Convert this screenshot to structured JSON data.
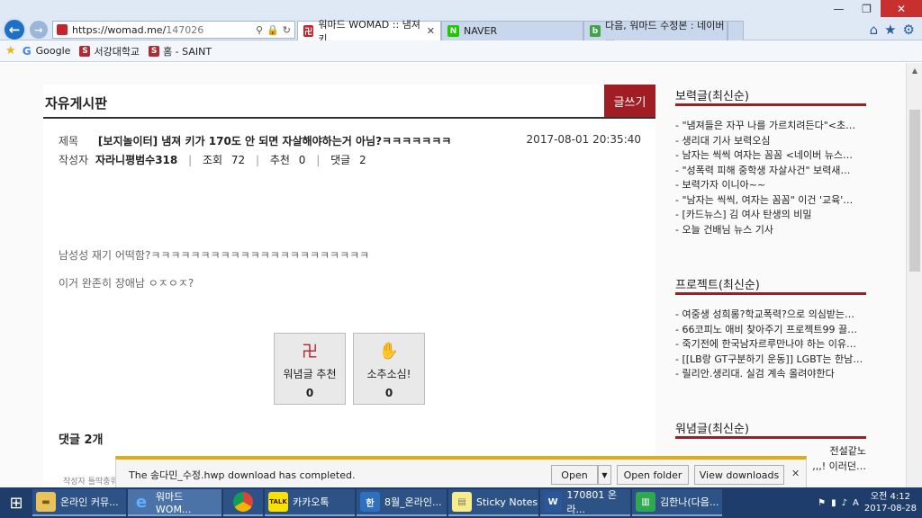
{
  "browser": {
    "url_prefix": "https://womad.me/",
    "url_path": "147026",
    "tabs": [
      {
        "label": "워마드 WOMAD :: 냄져 키...",
        "active": true
      },
      {
        "label": "NAVER",
        "active": false
      },
      {
        "label": "다음, 워마드 수정본 : 네이버 ...",
        "active": false
      }
    ],
    "favorites": [
      "Google",
      "서강대학교",
      "홈 - SAINT"
    ]
  },
  "board": {
    "title": "자유게시판",
    "write_label": "글쓰기",
    "post": {
      "subject_label": "제목",
      "subject": "[보지놀이터] 냄져 키가 170도 안 되면 자살해야하는거 아님?ㅋㅋㅋㅋㅋㅋㅋ",
      "date": "2017-08-01 20:35:40",
      "author_label": "작성자",
      "author": "자라니평범수318",
      "views_label": "조회",
      "views": "72",
      "likes_label": "추천",
      "likes": "0",
      "comments_label": "댓글",
      "comments": "2",
      "body_lines": [
        "남성성 재기 어떡함?ㅋㅋㅋㅋㅋㅋㅋㅋㅋㅋㅋㅋㅋㅋㅋㅋㅋㅋㅋㅋㅋㅋ",
        "이거 완존히 장애남 ㅇㅈㅇㅈ?"
      ]
    },
    "votes": [
      {
        "label": "워념글 추천",
        "count": "0",
        "icon": "womad-symbol-icon"
      },
      {
        "label": "소추소심!",
        "count": "0",
        "icon": "pinch-hand-icon"
      }
    ],
    "comment_heading": "댓글 2개",
    "comment_preview": "작성자 틀딱충워"
  },
  "sidebar": {
    "sections": [
      {
        "title": "보력글(최신순)",
        "items": [
          "- \"냄져들은 자꾸 나를 가르치려든다\"<초…",
          "- 생리대 기사 보력오심",
          "- 남자는 씩씩 여자는 꼼꼼 <네이버 뉴스…",
          "- \"성폭력 피해 중학생 자살사건\" 보력새…",
          "- 보력가자 이니아~~",
          "- \"남자는 씩씩, 여자는 꼼꼼\" 이건 '교육'…",
          "- [카드뉴스] 김 여사 탄생의 비밀",
          "- 오늘 건배님 뉴스 기사"
        ]
      },
      {
        "title": "프로젝트(최신순)",
        "items": [
          "- 여중생 성희롱?학교폭력?으로 의심받는…",
          "- 66코피노 애비 찾아주기 프로젝트99 끌…",
          "- 죽기전에 한국남자르루만나야 하는 이유…",
          "- [[LB랑 GT구분하기 운동]] LGBT는 한남…",
          "- 릴리안.생리대. 실검 계속 올려야한다"
        ]
      },
      {
        "title": "워념글(최신순)",
        "items": [
          "전설같노",
          ",,,! 이러던…"
        ]
      }
    ]
  },
  "download": {
    "message": "The 송다민_수정.hwp download has completed.",
    "open": "Open",
    "open_folder": "Open folder",
    "view_downloads": "View downloads"
  },
  "taskbar": {
    "items": [
      "온라인 커뮤...",
      "워마드 WOM...",
      "",
      "카카오톡",
      "8월_온라인...",
      "Sticky Notes",
      "170801 온라...",
      "김한나(다음..."
    ],
    "time": "오전 4:12",
    "date": "2017-08-28"
  },
  "colors": {
    "accent": "#a01d24",
    "download_bar": "#e3a917",
    "taskbar": "#1f3d6b"
  }
}
